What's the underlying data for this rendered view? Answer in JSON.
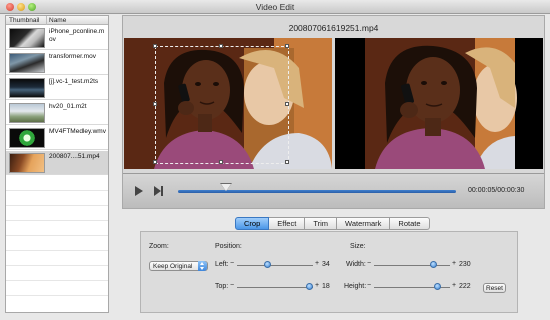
{
  "window": {
    "title": "Video Edit"
  },
  "sidebar": {
    "columns": {
      "thumbnail": "Thumbnail",
      "name": "Name"
    },
    "items": [
      {
        "name": "iPhone_pconline.mov"
      },
      {
        "name": "transformer.mov"
      },
      {
        "name": "[j].vc-1_test.m2ts"
      },
      {
        "name": "hv20_01.m2t"
      },
      {
        "name": "MV4FTMedley.wmv"
      },
      {
        "name": "200807....51.mp4"
      }
    ],
    "selected_index": 5
  },
  "preview": {
    "file_title": "200807061619251.mp4",
    "timecode": "00:00:05/00:00:30",
    "progress_fraction": 0.17
  },
  "tabs": [
    {
      "label": "Crop",
      "active": true
    },
    {
      "label": "Effect",
      "active": false
    },
    {
      "label": "Trim",
      "active": false
    },
    {
      "label": "Watermark",
      "active": false
    },
    {
      "label": "Rotate",
      "active": false
    }
  ],
  "crop": {
    "zoom_label": "Zoom:",
    "zoom_value": "Keep Original",
    "position_label": "Position:",
    "left_label": "Left:",
    "left_value": "34",
    "top_label": "Top:",
    "top_value": "18",
    "size_label": "Size:",
    "width_label": "Width:",
    "width_value": "230",
    "height_label": "Height:",
    "height_value": "222",
    "reset_label": "Reset",
    "minus": "−",
    "plus": "+"
  },
  "colors": {
    "accent": "#4b97e8",
    "seek": "#3f7fcf"
  }
}
